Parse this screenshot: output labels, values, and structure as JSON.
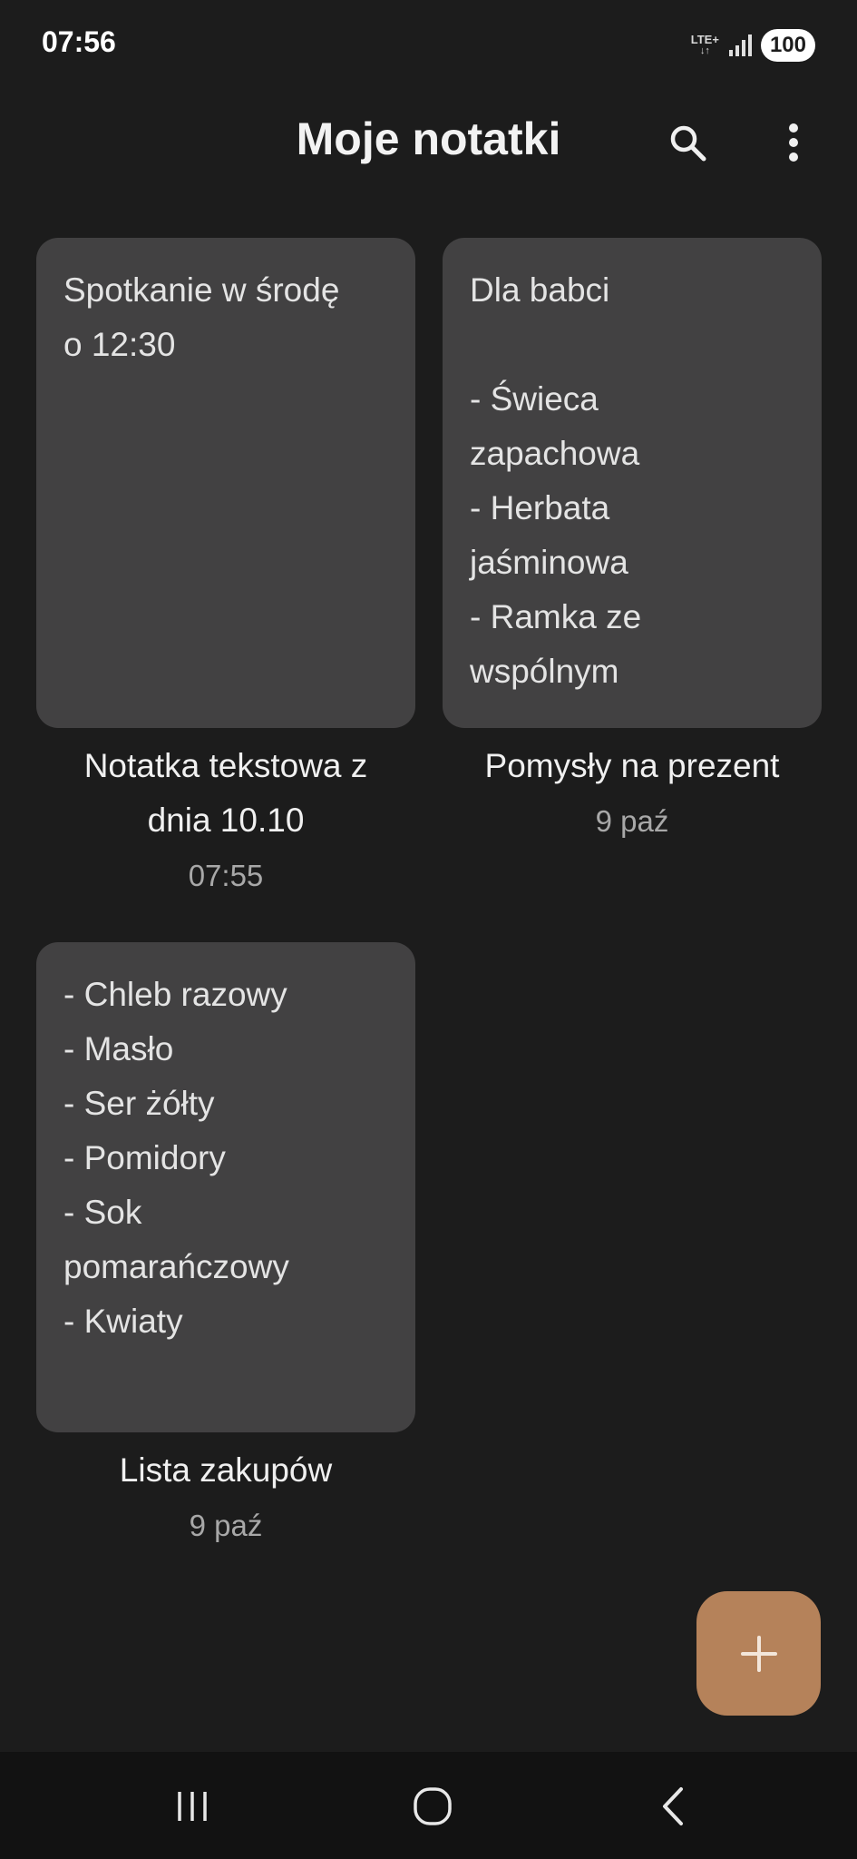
{
  "status_bar": {
    "time": "07:56",
    "network": "LTE+",
    "network_arrows": "↓↑",
    "battery": "100"
  },
  "header": {
    "title": "Moje notatki",
    "search_icon": "search-icon",
    "more_icon": "more-vert-icon"
  },
  "notes": [
    {
      "body": [
        "Spotkanie w środę",
        "o 12:30"
      ],
      "title": [
        "Notatka tekstowa z",
        "dnia 10.10"
      ],
      "date": "07:55"
    },
    {
      "body": [
        "Dla babci",
        "",
        "- Świeca",
        "zapachowa",
        "- Herbata",
        "jaśminowa",
        "- Ramka ze",
        "wspólnym"
      ],
      "title": [
        "Pomysły na prezent"
      ],
      "date": "9 paź"
    },
    {
      "body": [
        "- Chleb razowy",
        "- Masło",
        "- Ser żółty",
        "- Pomidory",
        "- Sok",
        "pomarańczowy",
        "- Kwiaty"
      ],
      "title": [
        "Lista zakupów"
      ],
      "date": "9 paź"
    }
  ],
  "fab": {
    "icon": "plus-icon",
    "color": "#b5825a"
  },
  "nav": {
    "recents_icon": "recents-icon",
    "home_icon": "home-icon",
    "back_icon": "back-icon"
  },
  "colors": {
    "background": "#1c1c1c",
    "card": "#424142",
    "nav_bar": "#121212"
  }
}
